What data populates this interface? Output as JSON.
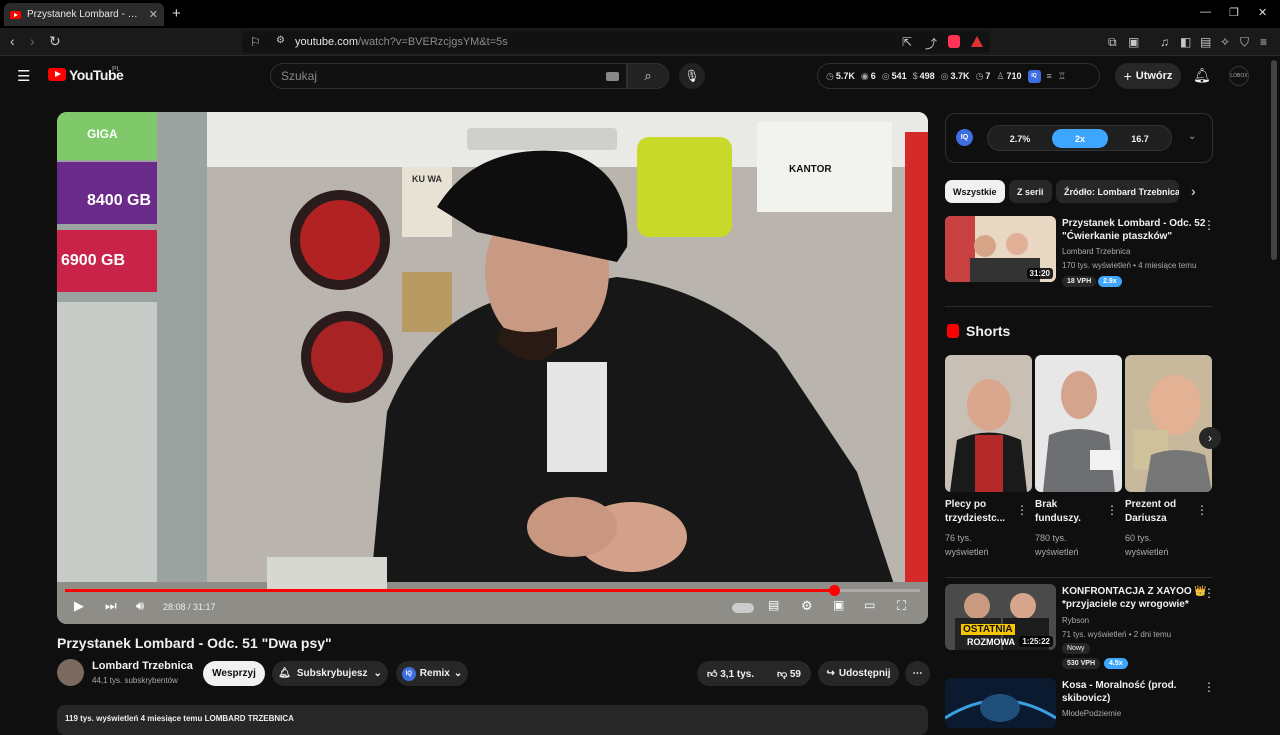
{
  "browser": {
    "tab_title": "Przystanek Lombard - Odc. 51 \"D",
    "tab_close": "✕",
    "new_tab": "+",
    "url_host": "youtube.com",
    "url_path": "/watch?v=BVERzcjgsYM&t=5s"
  },
  "header": {
    "logo_text": "YouTube",
    "logo_country": "PL",
    "search_placeholder": "Szukaj",
    "stats": [
      {
        "icon": "clock-icon",
        "value": "5.7K"
      },
      {
        "icon": "eye-icon",
        "value": "6"
      },
      {
        "icon": "eye-icon",
        "value": "541"
      },
      {
        "icon": "tag-icon",
        "value": "498"
      },
      {
        "icon": "eye-icon",
        "value": "3.7K"
      },
      {
        "icon": "timer-icon",
        "value": "7"
      },
      {
        "icon": "user-icon",
        "value": "710"
      }
    ],
    "create_label": "Utwórz",
    "avatar_text": "LOBOX"
  },
  "player": {
    "timecode": "28:08 / 31:17",
    "progress": 0.899,
    "sign_text": "KANTOR",
    "sim_texts": [
      "8400 GB",
      "6900 GB",
      "GIGA"
    ],
    "notice_text": "KU WA"
  },
  "video": {
    "title": "Przystanek Lombard - Odc. 51 \"Dwa psy\"",
    "channel_name": "Lombard Trzebnica",
    "subscribers": "44,1 tys. subskrybentów",
    "support_label": "Wesprzyj",
    "subscribed_label": "Subskrybujesz",
    "remix_label": "Remix",
    "likes": "3,1 tys.",
    "dislikes": "59",
    "share_label": "Udostępnij",
    "description_line": "119 tys. wyświetleń  4 miesiące temu  LOMBARD TRZEBNICA"
  },
  "iq_panel": {
    "badge": "IQ",
    "values": [
      "2.7%",
      "2x",
      "16.7"
    ]
  },
  "chips": [
    "Wszystkie",
    "Z serii",
    "Źródło: Lombard Trzebnica"
  ],
  "recommended": [
    {
      "title_line1": "Przystanek Lombard - Odc. 52",
      "title_line2": "\"Ćwierkanie ptaszków\"",
      "channel": "Lombard Trzebnica",
      "meta": "170 tys. wyświetleń • 4 miesiące temu",
      "duration": "31:20",
      "vph": "18 VPH",
      "mult": "2.9x"
    },
    {
      "title_line1": "KONFRONTACJA Z XAYOO 👑",
      "title_line2": "*przyjaciele czy wrogowie*",
      "channel": "Rybson",
      "meta": "71 tys. wyświetleń • 2 dni temu",
      "badge": "Nowy",
      "duration": "1:25:22",
      "vph": "530 VPH",
      "mult": "4.5x",
      "thumb_text1": "OSTATNIA",
      "thumb_text2": "ROZMOWA"
    },
    {
      "title_line1": "Kosa - Moralność (prod.",
      "title_line2": "skibovicz)",
      "channel": "MłodePodziemie"
    }
  ],
  "shorts": {
    "heading": "Shorts",
    "items": [
      {
        "title1": "Plecy po",
        "title2": "trzydziestc...",
        "views1": "76 tys.",
        "views2": "wyświetleń"
      },
      {
        "title1": "Brak",
        "title2": "funduszy.",
        "views1": "780 tys.",
        "views2": "wyświetleń"
      },
      {
        "title1": "Prezent od",
        "title2": "Dariusza",
        "views1": "60 tys.",
        "views2": "wyświetleń"
      }
    ]
  }
}
